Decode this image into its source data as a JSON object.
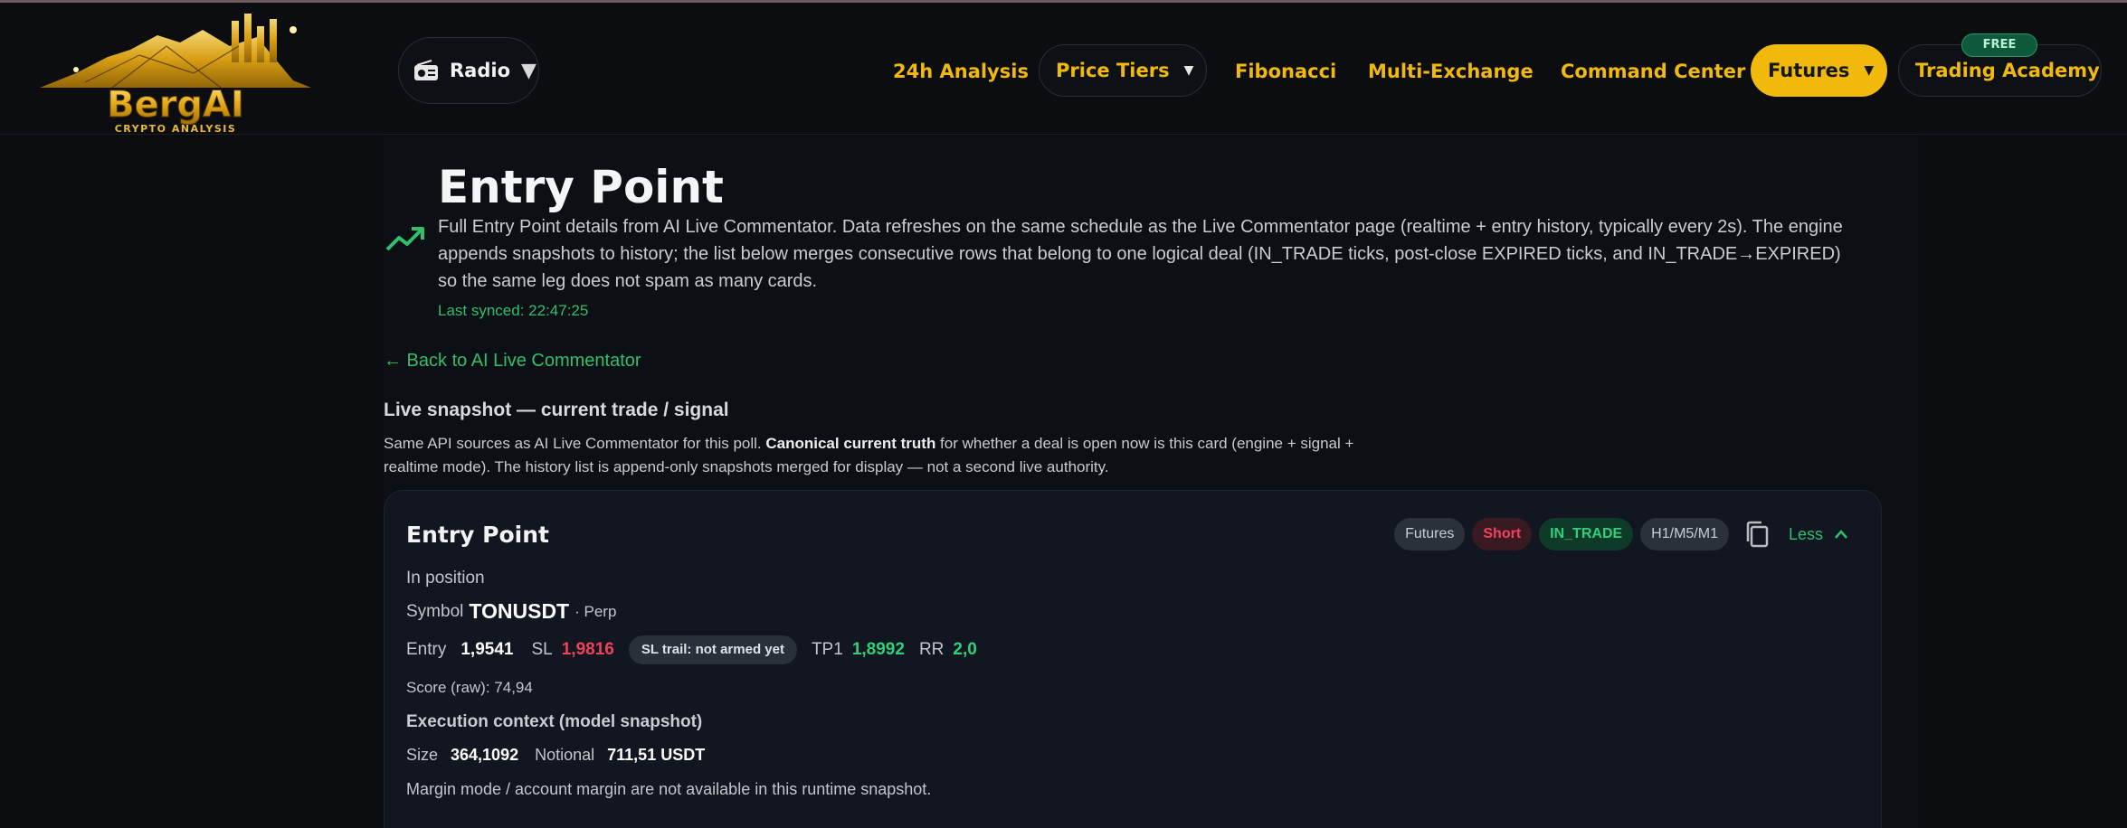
{
  "brand": {
    "name": "BergAI",
    "tagline": "CRYPTO ANALYSIS"
  },
  "header": {
    "radio_label": "Radio",
    "nav": {
      "analysis": "24h Analysis",
      "price_tiers": "Price Tiers",
      "fibonacci": "Fibonacci",
      "multi_exchange": "Multi-Exchange",
      "command_center": "Command Center",
      "futures": "Futures",
      "academy": "Trading Academy",
      "academy_badge": "FREE"
    }
  },
  "page": {
    "title": "Entry Point",
    "description": "Full Entry Point details from AI Live Commentator. Data refreshes on the same schedule as the Live Commentator page (realtime + entry history, typically every 2s). The engine appends snapshots to history; the list below merges consecutive rows that belong to one logical deal (IN_TRADE ticks, post-close EXPIRED ticks, and IN_TRADE→EXPIRED) so the same leg does not spam as many cards.",
    "last_synced": "Last synced: 22:47:25",
    "back_link": "← Back to AI Live Commentator"
  },
  "snapshot": {
    "title": "Live snapshot — current trade / signal",
    "desc_pre": "Same API sources as AI Live Commentator for this poll. ",
    "desc_bold": "Canonical current truth",
    "desc_post": " for whether a deal is open now is this card (engine + signal + realtime mode). The history list is append-only snapshots merged for display — not a second live authority."
  },
  "card": {
    "title": "Entry Point",
    "tags": {
      "market": "Futures",
      "side": "Short",
      "status": "IN_TRADE",
      "timeframes": "H1/M5/M1"
    },
    "less_label": "Less",
    "state": "In position",
    "symbol_label": "Symbol",
    "symbol": "TONUSDT",
    "symbol_suffix": "· Perp",
    "entry_label": "Entry",
    "entry": "1,9541",
    "sl_label": "SL",
    "sl": "1,9816",
    "sl_trail": "SL trail: not armed yet",
    "tp1_label": "TP1",
    "tp1": "1,8992",
    "rr_label": "RR",
    "rr": "2,0",
    "score": "Score (raw): 74,94",
    "exec_title": "Execution context (model snapshot)",
    "size_label": "Size",
    "size": "364,1092",
    "notional_label": "Notional",
    "notional": "711,51 USDT",
    "margin_note": "Margin mode / account margin are not available in this runtime snapshot."
  },
  "colors": {
    "accent": "#f0b90b",
    "positive": "#2fd07a",
    "negative": "#f0415a",
    "link": "#2fbf6e"
  }
}
